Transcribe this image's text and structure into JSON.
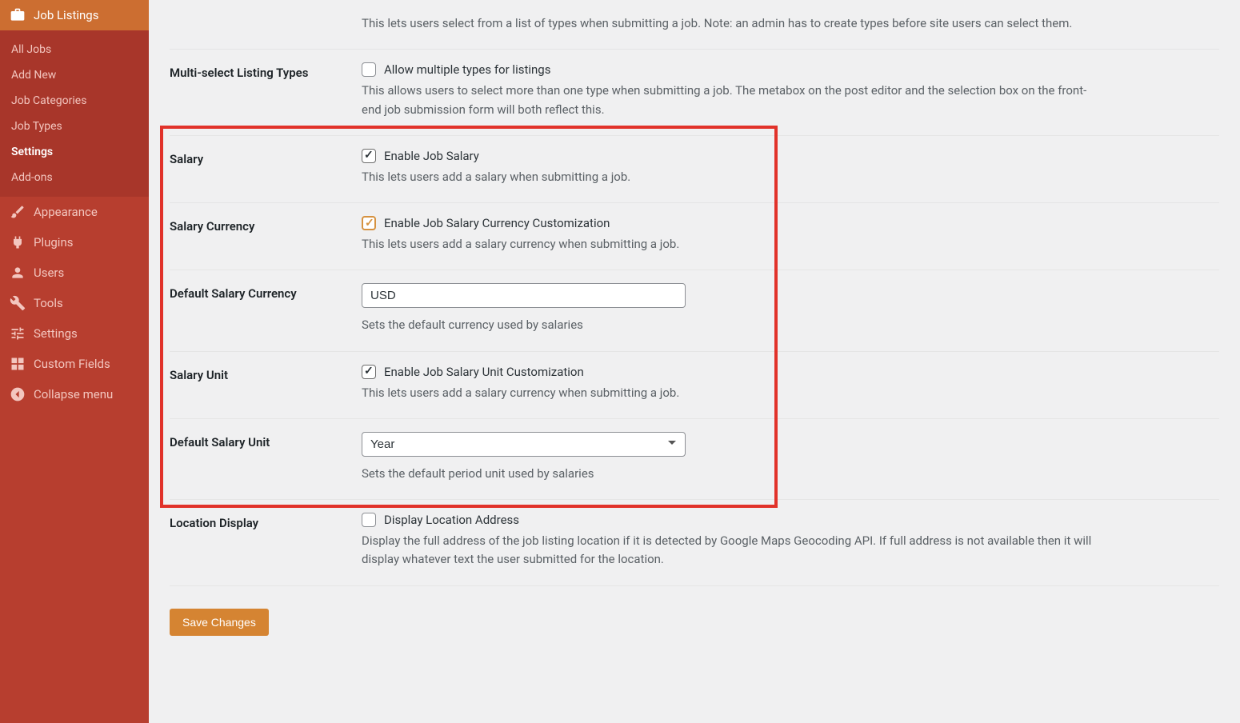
{
  "sidebar": {
    "jobListings": {
      "label": "Job Listings"
    },
    "submenu": {
      "allJobs": "All Jobs",
      "addNew": "Add New",
      "jobCategories": "Job Categories",
      "jobTypes": "Job Types",
      "settings": "Settings",
      "addons": "Add-ons"
    },
    "appearance": "Appearance",
    "plugins": "Plugins",
    "users": "Users",
    "tools": "Tools",
    "settings": "Settings",
    "customFields": "Custom Fields",
    "collapse": "Collapse menu"
  },
  "settings": {
    "listingTypesDesc": "This lets users select from a list of types when submitting a job. Note: an admin has to create types before site users can select them.",
    "multiSelect": {
      "label": "Multi-select Listing Types",
      "check": "Allow multiple types for listings",
      "desc": "This allows users to select more than one type when submitting a job. The metabox on the post editor and the selection box on the front-end job submission form will both reflect this."
    },
    "salary": {
      "label": "Salary",
      "check": "Enable Job Salary",
      "desc": "This lets users add a salary when submitting a job."
    },
    "salaryCurrency": {
      "label": "Salary Currency",
      "check": "Enable Job Salary Currency Customization",
      "desc": "This lets users add a salary currency when submitting a job."
    },
    "defaultCurrency": {
      "label": "Default Salary Currency",
      "value": "USD",
      "desc": "Sets the default currency used by salaries"
    },
    "salaryUnit": {
      "label": "Salary Unit",
      "check": "Enable Job Salary Unit Customization",
      "desc": "This lets users add a salary currency when submitting a job."
    },
    "defaultUnit": {
      "label": "Default Salary Unit",
      "value": "Year",
      "desc": "Sets the default period unit used by salaries"
    },
    "locationDisplay": {
      "label": "Location Display",
      "check": "Display Location Address",
      "desc": "Display the full address of the job listing location if it is detected by Google Maps Geocoding API. If full address is not available then it will display whatever text the user submitted for the location."
    },
    "saveButton": "Save Changes"
  }
}
